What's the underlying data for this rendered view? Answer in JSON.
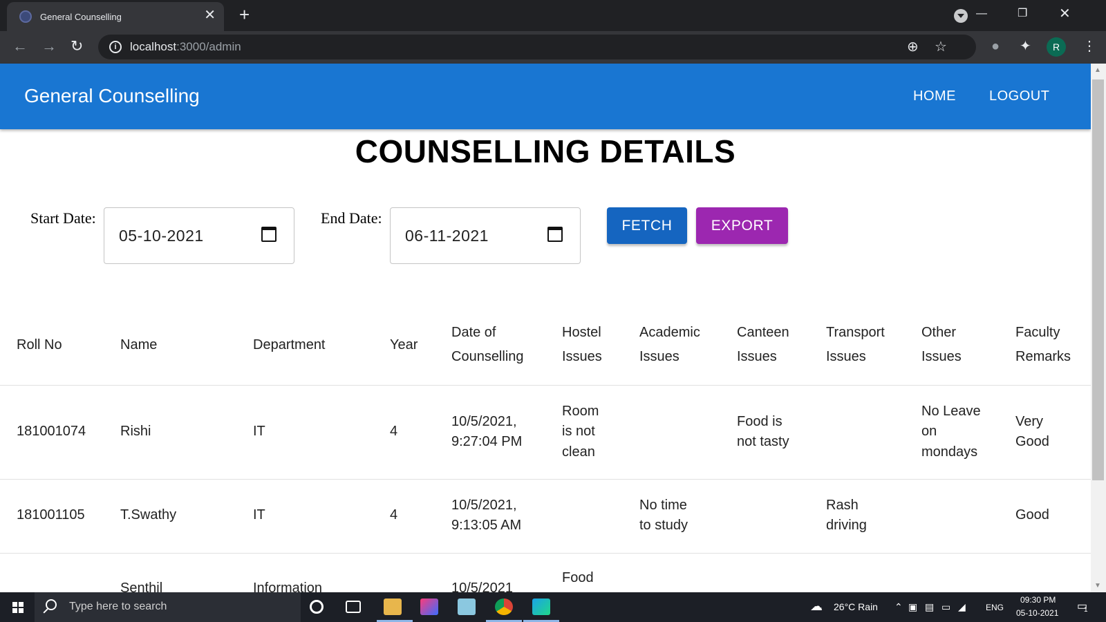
{
  "browser": {
    "tab_title": "General Counselling",
    "tab_close": "✕",
    "new_tab": "+",
    "url_host": "localhost",
    "url_path": ":3000/admin",
    "profile_initial": "R"
  },
  "app": {
    "title": "General Counselling",
    "nav": {
      "home": "HOME",
      "logout": "LOGOUT"
    },
    "heading": "COUNSELLING DETAILS",
    "filters": {
      "start_label": "Start Date:",
      "start_value": "05-10-2021",
      "end_label": "End Date:",
      "end_value": "06-11-2021",
      "fetch_label": "FETCH",
      "export_label": "EXPORT"
    },
    "table": {
      "headers": {
        "roll": "Roll No",
        "name": "Name",
        "dept": "Department",
        "year": "Year",
        "date_1": "Date of",
        "date_2": "Counselling",
        "hostel_1": "Hostel",
        "hostel_2": "Issues",
        "academic_1": "Academic",
        "academic_2": "Issues",
        "canteen_1": "Canteen",
        "canteen_2": "Issues",
        "transport_1": "Transport",
        "transport_2": "Issues",
        "other_1": "Other",
        "other_2": "Issues",
        "remarks_1": "Faculty",
        "remarks_2": "Remarks"
      },
      "rows": [
        {
          "roll": "181001074",
          "name": "Rishi",
          "dept": "IT",
          "year": "4",
          "date_1": "10/5/2021,",
          "date_2": "9:27:04 PM",
          "hostel_1": "Room",
          "hostel_2": "is not",
          "hostel_3": "clean",
          "academic": "",
          "canteen_1": "Food is",
          "canteen_2": "not tasty",
          "transport": "",
          "other_1": "No Leave",
          "other_2": "on",
          "other_3": "mondays",
          "remarks_1": "Very",
          "remarks_2": "Good"
        },
        {
          "roll": "181001105",
          "name": "T.Swathy",
          "dept": "IT",
          "year": "4",
          "date_1": "10/5/2021,",
          "date_2": "9:13:05 AM",
          "hostel": "",
          "academic_1": "No time",
          "academic_2": "to study",
          "canteen": "",
          "transport_1": "Rash",
          "transport_2": "driving",
          "other": "",
          "remarks": "Good"
        },
        {
          "name": "Senthil",
          "dept": "Information",
          "date_1": "10/5/2021",
          "hostel_1": "Food"
        }
      ]
    }
  },
  "taskbar": {
    "search_placeholder": "Type here to search",
    "weather": "26°C  Rain",
    "language": "ENG",
    "time": "09:30 PM",
    "date": "05-10-2021",
    "notification_count": "1"
  },
  "colors": {
    "app_bar": "#1976d2",
    "fetch_button": "#1565c0",
    "export_button": "#9c27b0"
  }
}
